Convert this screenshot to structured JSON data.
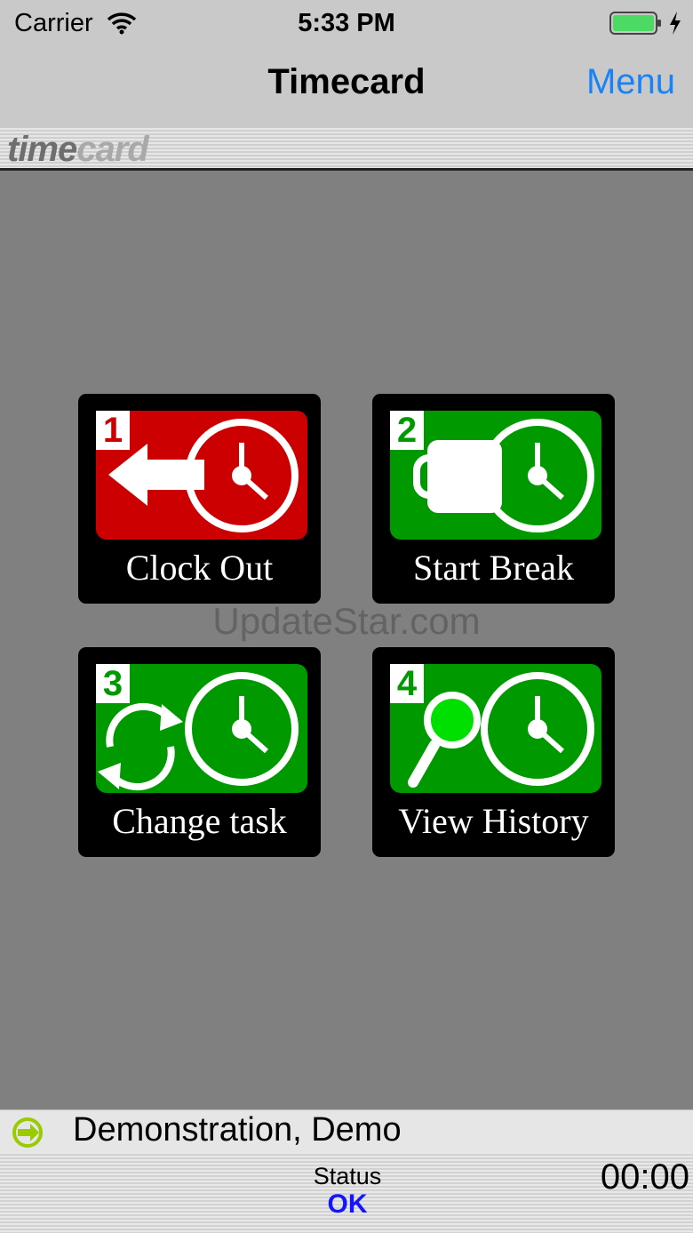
{
  "status_bar": {
    "carrier": "Carrier",
    "time": "5:33 PM"
  },
  "nav": {
    "title": "Timecard",
    "menu_label": "Menu"
  },
  "logo": {
    "part1": "time",
    "part2": "card"
  },
  "watermark": "UpdateStar.com",
  "tiles": [
    {
      "number": "1",
      "label": "Clock Out",
      "color": "#cc0000",
      "icon": "arrow-left-icon"
    },
    {
      "number": "2",
      "label": "Start Break",
      "color": "#009900",
      "icon": "coffee-mug-icon"
    },
    {
      "number": "3",
      "label": "Change task",
      "color": "#009900",
      "icon": "cycle-arrows-icon"
    },
    {
      "number": "4",
      "label": "View History",
      "color": "#009900",
      "icon": "magnifier-icon"
    }
  ],
  "user": {
    "name": "Demonstration, Demo"
  },
  "footer": {
    "status_label": "Status",
    "status_value": "OK",
    "clock": "00:00"
  },
  "colors": {
    "menu_blue": "#1a82f7",
    "status_ok": "#1414ff",
    "battery": "#4cd964",
    "user_icon": "#99cc00"
  }
}
